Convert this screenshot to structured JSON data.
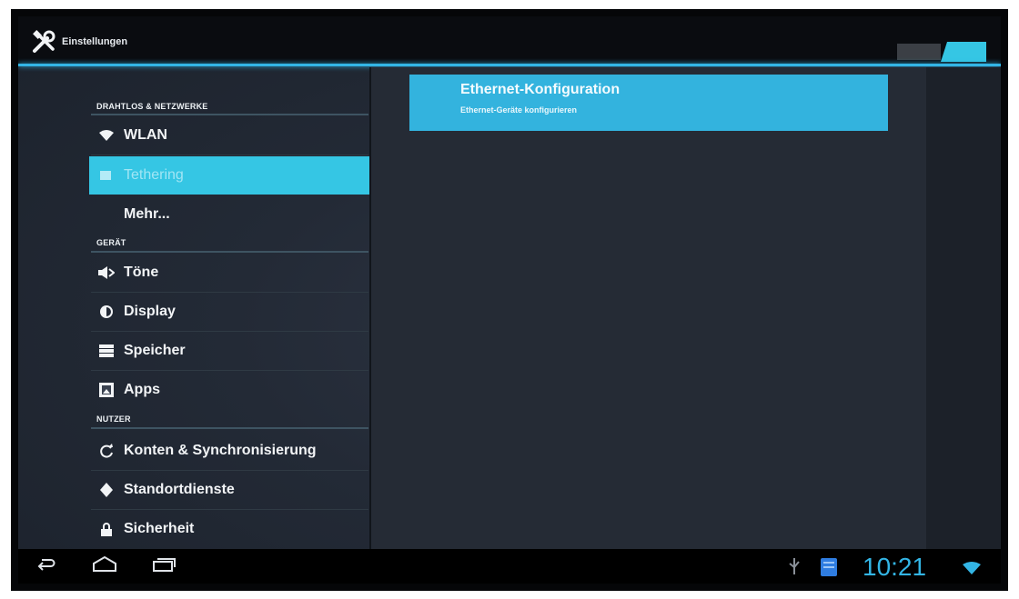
{
  "actionbar": {
    "title": "Einstellungen"
  },
  "sections": {
    "wireless": "DRAHTLOS & NETZWERKE",
    "device": "GERÄT",
    "user": "NUTZER"
  },
  "items": {
    "wlan": "WLAN",
    "selected": "Tethering",
    "more": "Mehr...",
    "sound": "Töne",
    "display": "Display",
    "storage": "Speicher",
    "apps": "Apps",
    "accounts": "Konten & Synchronisierung",
    "location": "Standortdienste",
    "security": "Sicherheit"
  },
  "detail": {
    "title": "Ethernet-Konfiguration",
    "subtitle": "Ethernet-Geräte konfigurieren"
  },
  "status": {
    "time": "10:21"
  },
  "colors": {
    "accent": "#33b5e5",
    "background": "#232a36",
    "bar": "#000000"
  }
}
